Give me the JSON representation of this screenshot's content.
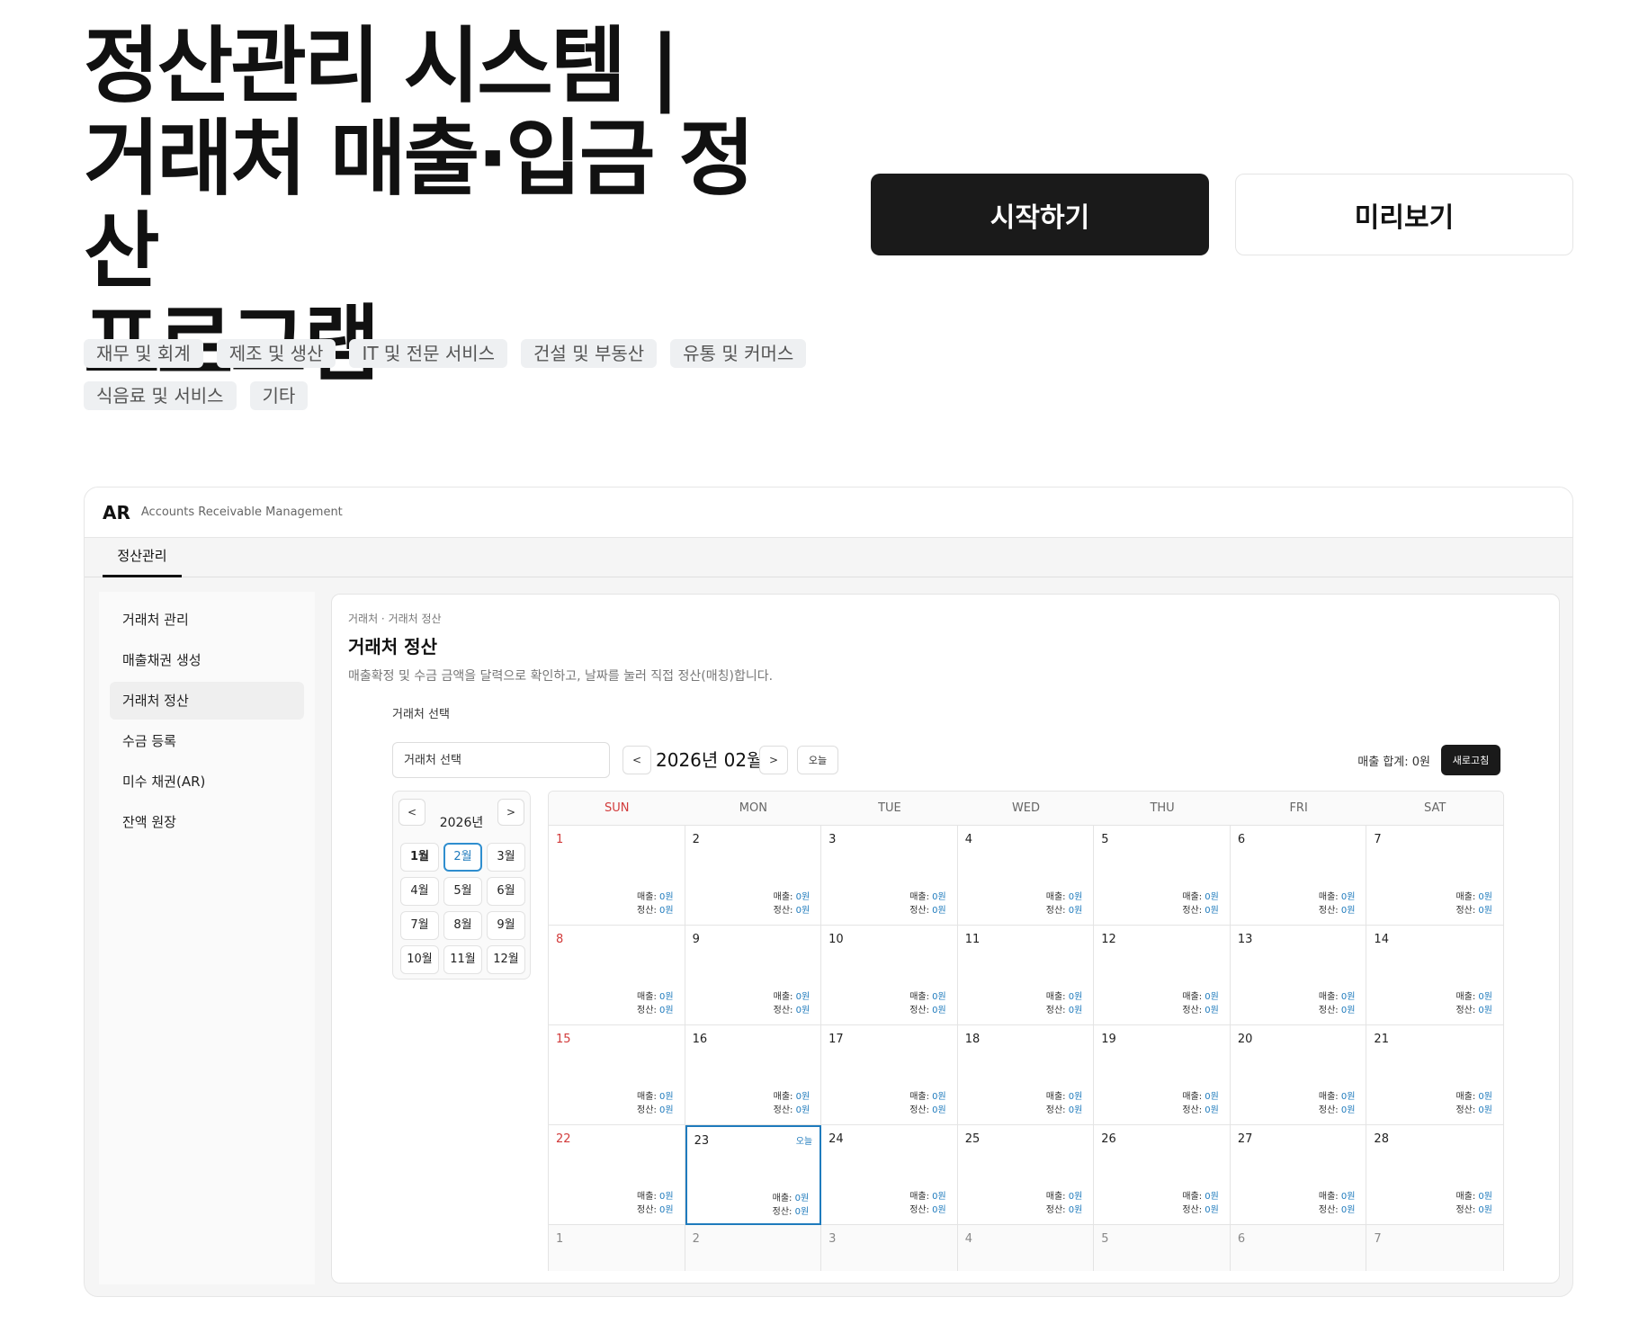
{
  "hero": {
    "title_lines": [
      "정산관리 시스템 |",
      "거래처 매출·입금 정산",
      "프로그램"
    ],
    "start_button": "시작하기",
    "preview_button": "미리보기"
  },
  "tags": [
    "재무 및 회계",
    "제조 및 생산",
    "IT 및 전문 서비스",
    "건설 및 부동산",
    "유통 및 커머스",
    "식음료 및 서비스",
    "기타"
  ],
  "app": {
    "brand": "AR",
    "brand_sub": "Accounts Receivable Management",
    "tab": "정산관리",
    "sidebar": [
      "거래처 관리",
      "매출채권 생성",
      "거래처 정산",
      "수금 등록",
      "미수 채권(AR)",
      "잔액 원장"
    ],
    "active_sidebar_index": 2,
    "breadcrumb": "거래처 · 거래처 정산",
    "page_title": "거래처 정산",
    "page_desc": "매출확정 및 수금 금액을 달력으로 확인하고, 날짜를 눌러 직접 정산(매칭)합니다.",
    "select_label": "거래처 선택",
    "select_placeholder": "거래처 선택",
    "prev": "<",
    "next": ">",
    "month_title": "2026년 02월",
    "today_button": "오늘",
    "sales_total": "매출 합계: 0원",
    "refresh_button": "새로고침",
    "picker": {
      "year": "2026년",
      "months": [
        "1월",
        "2월",
        "3월",
        "4월",
        "5월",
        "6월",
        "7월",
        "8월",
        "9월",
        "10월",
        "11월",
        "12월"
      ],
      "selected_index": 1
    },
    "calendar": {
      "weekdays": [
        "SUN",
        "MON",
        "TUE",
        "WED",
        "THU",
        "FRI",
        "SAT"
      ],
      "sales_label": "매출: ",
      "settle_label": "정산: ",
      "zero_amount": "0원",
      "today_label": "오늘",
      "today_day": 23,
      "month_days": 28,
      "trailing_days": [
        "1",
        "2",
        "3",
        "4",
        "5",
        "6",
        "7"
      ]
    }
  }
}
